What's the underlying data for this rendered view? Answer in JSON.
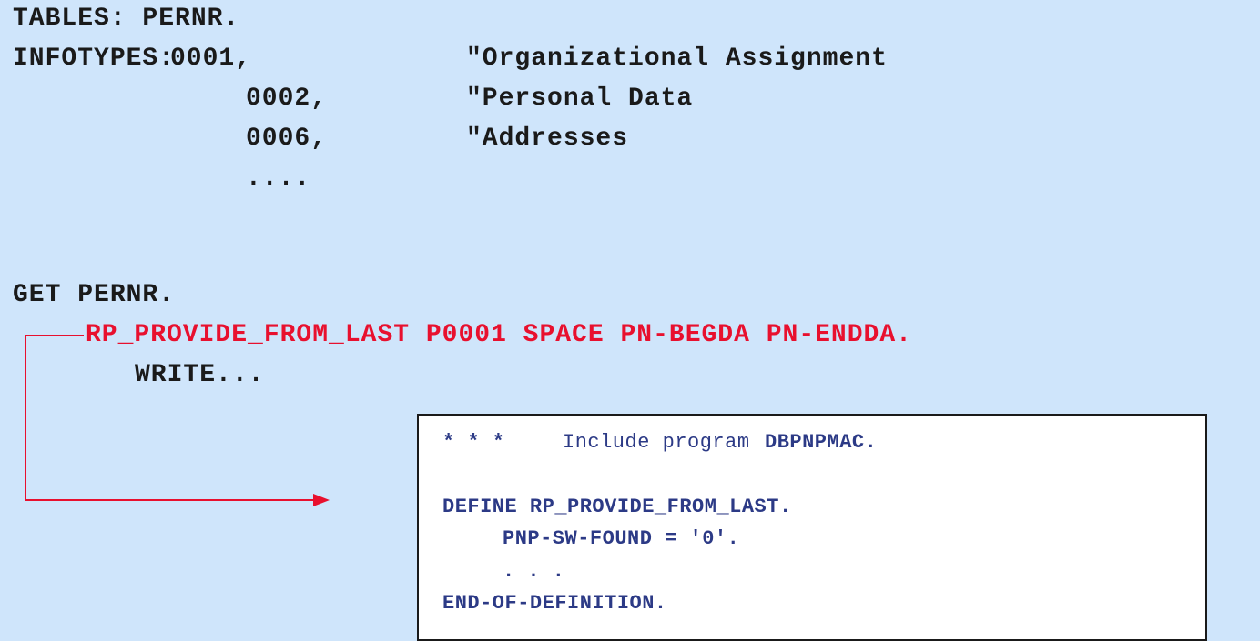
{
  "code": {
    "tables_line": "TABLES: PERNR.",
    "infotypes_keyword": "INFOTYPES:",
    "infotypes": [
      {
        "code": "0001,",
        "comment": "\"Organizational Assignment"
      },
      {
        "code": "0002,",
        "comment": "\"Personal Data"
      },
      {
        "code": "0006,",
        "comment": "\"Addresses"
      }
    ],
    "ellipsis": "....",
    "get_line": "GET PERNR.",
    "macro_call": "RP_PROVIDE_FROM_LAST P0001 SPACE PN-BEGDA PN-ENDDA.",
    "write_line": "WRITE..."
  },
  "include_box": {
    "stars": "* * *",
    "include_text": "Include program",
    "program_name": "DBPNPMAC.",
    "define_line": "DEFINE RP_PROVIDE_FROM_LAST.",
    "assignment_line": "PNP-SW-FOUND = '0'.",
    "dots": ". . .",
    "end_line": "END-OF-DEFINITION."
  },
  "colors": {
    "background": "#cfe5fb",
    "code_text": "#1a1a1a",
    "highlight": "#e8102e",
    "box_text": "#2c3a86",
    "box_background": "#ffffff"
  }
}
